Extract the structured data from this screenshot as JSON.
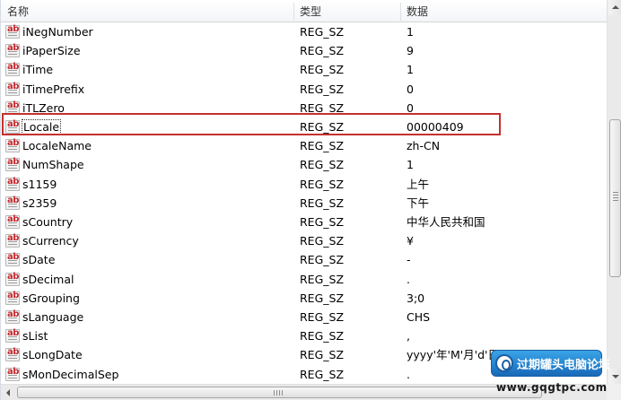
{
  "header": {
    "name_label": "名称",
    "type_label": "类型",
    "data_label": "数据"
  },
  "rows": [
    {
      "name": "iNegNumber",
      "type": "REG_SZ",
      "data": "1"
    },
    {
      "name": "iPaperSize",
      "type": "REG_SZ",
      "data": "9"
    },
    {
      "name": "iTime",
      "type": "REG_SZ",
      "data": "1"
    },
    {
      "name": "iTimePrefix",
      "type": "REG_SZ",
      "data": "0"
    },
    {
      "name": "iTLZero",
      "type": "REG_SZ",
      "data": "0"
    },
    {
      "name": "Locale",
      "type": "REG_SZ",
      "data": "00000409",
      "selected": true
    },
    {
      "name": "LocaleName",
      "type": "REG_SZ",
      "data": "zh-CN"
    },
    {
      "name": "NumShape",
      "type": "REG_SZ",
      "data": "1"
    },
    {
      "name": "s1159",
      "type": "REG_SZ",
      "data": "上午"
    },
    {
      "name": "s2359",
      "type": "REG_SZ",
      "data": "下午"
    },
    {
      "name": "sCountry",
      "type": "REG_SZ",
      "data": "中华人民共和国"
    },
    {
      "name": "sCurrency",
      "type": "REG_SZ",
      "data": "¥"
    },
    {
      "name": "sDate",
      "type": "REG_SZ",
      "data": "-"
    },
    {
      "name": "sDecimal",
      "type": "REG_SZ",
      "data": "."
    },
    {
      "name": "sGrouping",
      "type": "REG_SZ",
      "data": "3;0"
    },
    {
      "name": "sLanguage",
      "type": "REG_SZ",
      "data": "CHS"
    },
    {
      "name": "sList",
      "type": "REG_SZ",
      "data": ","
    },
    {
      "name": "sLongDate",
      "type": "REG_SZ",
      "data": "yyyy'年'M'月'd'日'"
    },
    {
      "name": "sMonDecimalSep",
      "type": "REG_SZ",
      "data": "."
    }
  ],
  "icon": "reg-sz-string-icon",
  "highlight_color": "#c4312f",
  "watermark": {
    "title": "过期罐头电脑论坛",
    "url": "www.gqgtpc.com"
  }
}
